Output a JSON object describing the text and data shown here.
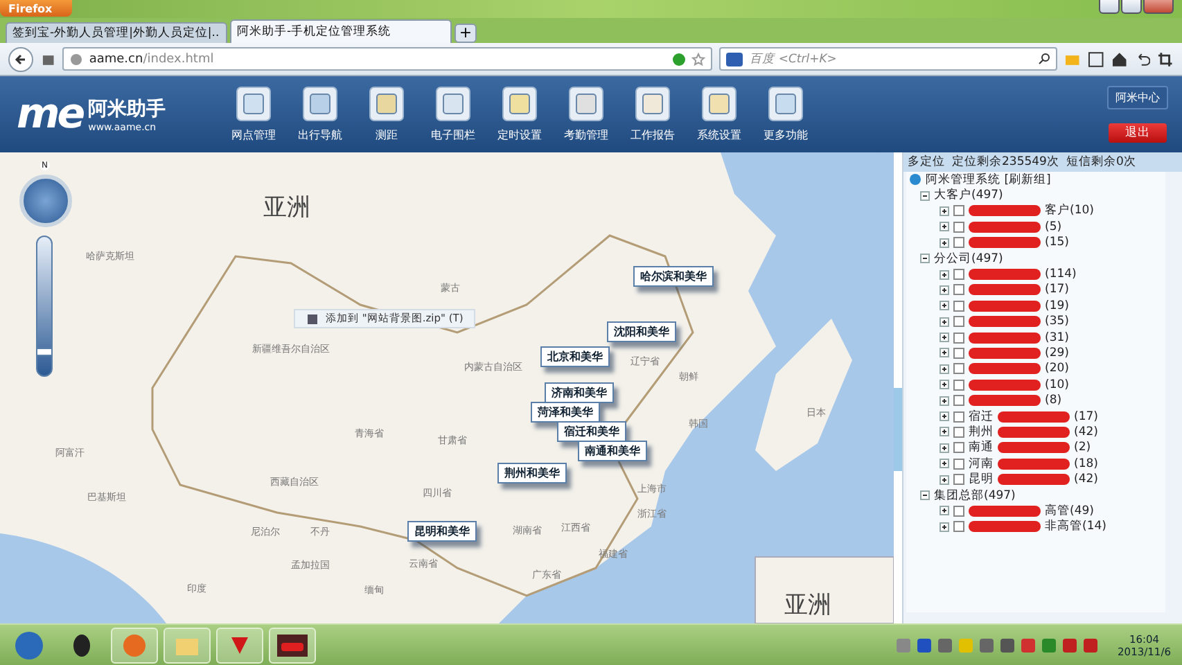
{
  "browser": {
    "menu_button": "Firefox",
    "tabs": [
      {
        "title": "签到宝-外勤人员管理|外勤人员定位|...",
        "selected": false
      },
      {
        "title": "阿米助手-手机定位管理系统",
        "selected": true
      }
    ],
    "new_tab": "+",
    "url_host": "aame.cn",
    "url_path": "/index.html",
    "search_placeholder": "百度 <Ctrl+K>"
  },
  "header": {
    "logo_mark": "me",
    "logo_name": "阿米助手",
    "logo_url": "www.aame.cn",
    "nav": [
      "网点管理",
      "出行导航",
      "测距",
      "电子围栏",
      "定时设置",
      "考勤管理",
      "工作报告",
      "系统设置",
      "更多功能"
    ],
    "account_button": "阿米中心",
    "logout_button": "退出"
  },
  "map": {
    "compass": "N",
    "zoom": {
      "level": 0.15
    },
    "labels": [
      {
        "text": "亚洲",
        "kind": "continent"
      },
      {
        "text": "哈萨克斯坦",
        "kind": "region"
      },
      {
        "text": "蒙古",
        "kind": "region"
      },
      {
        "text": "新疆维吾尔自治区",
        "kind": "region"
      },
      {
        "text": "内蒙古自治区",
        "kind": "region"
      },
      {
        "text": "青海省",
        "kind": "region"
      },
      {
        "text": "甘肃省",
        "kind": "region"
      },
      {
        "text": "西藏自治区",
        "kind": "region"
      },
      {
        "text": "四川省",
        "kind": "region"
      },
      {
        "text": "阿富汗",
        "kind": "region"
      },
      {
        "text": "巴基斯坦",
        "kind": "region"
      },
      {
        "text": "尼泊尔",
        "kind": "region"
      },
      {
        "text": "不丹",
        "kind": "region"
      },
      {
        "text": "印度",
        "kind": "region"
      },
      {
        "text": "孟加拉国",
        "kind": "region"
      },
      {
        "text": "缅甸",
        "kind": "region"
      },
      {
        "text": "云南省",
        "kind": "region"
      },
      {
        "text": "湖南省",
        "kind": "region"
      },
      {
        "text": "江西省",
        "kind": "region"
      },
      {
        "text": "浙江省",
        "kind": "region"
      },
      {
        "text": "福建省",
        "kind": "region"
      },
      {
        "text": "广东省",
        "kind": "region"
      },
      {
        "text": "辽宁省",
        "kind": "region"
      },
      {
        "text": "朝鲜",
        "kind": "region"
      },
      {
        "text": "韩国",
        "kind": "region"
      },
      {
        "text": "日本",
        "kind": "region"
      },
      {
        "text": "上海市",
        "kind": "region"
      },
      {
        "text": "亚洲",
        "kind": "continent"
      }
    ],
    "markers": [
      "哈尔滨和美华",
      "沈阳和美华",
      "北京和美华",
      "济南和美华",
      "菏泽和美华",
      "宿迁和美华",
      "南通和美华",
      "荆州和美华",
      "昆明和美华"
    ],
    "tooltip": "添加到 \"网站背景图.zip\" (T)"
  },
  "panel": {
    "mode": "多定位",
    "quota_location": "定位剩余235549次",
    "quota_sms": "短信剩余0次",
    "root": "阿米管理系统 [刷新组]",
    "groups": [
      {
        "label": "大客户(497)",
        "expanded": true,
        "children": [
          {
            "suffix": "客户(10)",
            "expanded": false,
            "checked": false
          },
          {
            "suffix": "(5)",
            "expanded": false,
            "checked": false
          },
          {
            "suffix": "(15)",
            "expanded": false,
            "checked": false
          }
        ]
      },
      {
        "label": "分公司(497)",
        "expanded": true,
        "children": [
          {
            "suffix": "(114)",
            "expanded": false,
            "checked": false
          },
          {
            "suffix": "(17)",
            "expanded": false,
            "checked": false
          },
          {
            "suffix": "(19)",
            "expanded": false,
            "checked": false
          },
          {
            "suffix": "(35)",
            "expanded": false,
            "checked": false
          },
          {
            "suffix": "(31)",
            "expanded": false,
            "checked": false
          },
          {
            "suffix": "(29)",
            "expanded": false,
            "checked": false
          },
          {
            "suffix": "(20)",
            "expanded": false,
            "checked": false
          },
          {
            "suffix": "(10)",
            "expanded": false,
            "checked": false
          },
          {
            "suffix": "(8)",
            "expanded": false,
            "checked": false
          },
          {
            "prefix": "宿迁",
            "suffix": "(17)",
            "expanded": false,
            "checked": false
          },
          {
            "prefix": "荆州",
            "suffix": "(42)",
            "expanded": false,
            "checked": false
          },
          {
            "prefix": "南通",
            "suffix": "(2)",
            "expanded": false,
            "checked": false
          },
          {
            "prefix": "河南",
            "suffix": "(18)",
            "expanded": false,
            "checked": false
          },
          {
            "prefix": "昆明",
            "suffix": "(42)",
            "expanded": false,
            "checked": false
          }
        ]
      },
      {
        "label": "集团总部(497)",
        "expanded": true,
        "children": [
          {
            "suffix": "高管(49)",
            "expanded": false,
            "checked": false
          },
          {
            "suffix": "非高管(14)",
            "expanded": false,
            "checked": false
          }
        ]
      }
    ]
  },
  "taskbar": {
    "time": "16:04",
    "date": "2013/11/6"
  }
}
